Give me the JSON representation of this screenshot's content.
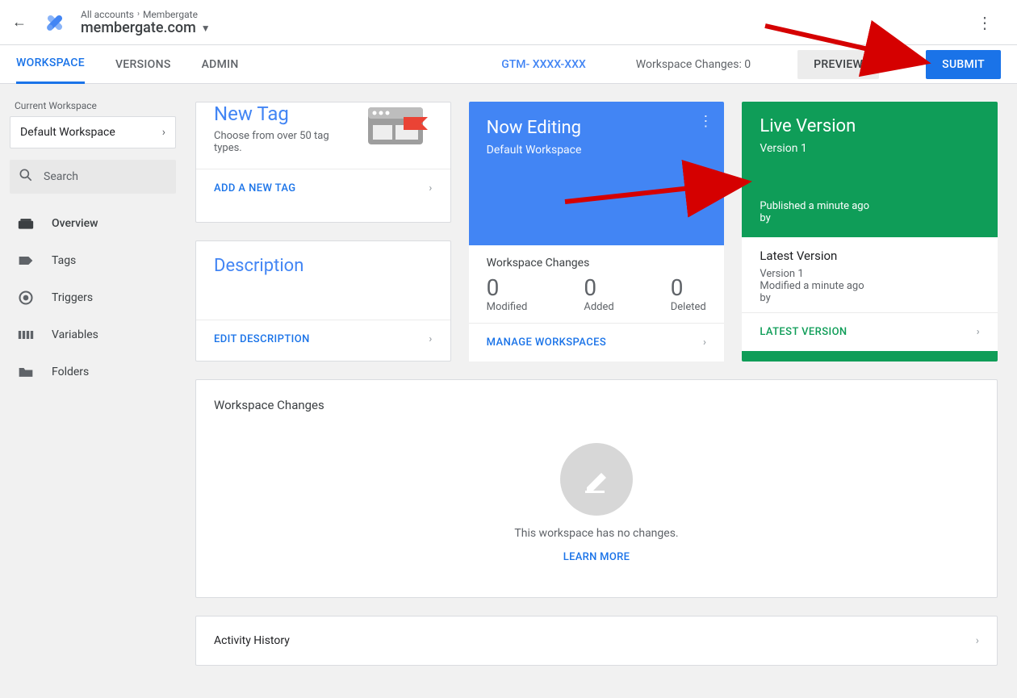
{
  "header": {
    "breadcrumb": {
      "root": "All accounts",
      "leaf": "Membergate"
    },
    "container": "membergate.com"
  },
  "subnav": {
    "tabs": {
      "workspace": "WORKSPACE",
      "versions": "VERSIONS",
      "admin": "ADMIN"
    },
    "gtm_id": "GTM- XXXX-XXX",
    "changes_label": "Workspace Changes: 0",
    "preview": "PREVIEW",
    "submit": "SUBMIT"
  },
  "sidebar": {
    "current_label": "Current Workspace",
    "workspace": "Default Workspace",
    "search_placeholder": "Search",
    "items": {
      "overview": "Overview",
      "tags": "Tags",
      "triggers": "Triggers",
      "variables": "Variables",
      "folders": "Folders"
    }
  },
  "cards": {
    "newtag": {
      "title": "New Tag",
      "sub": "Choose from over 50 tag types.",
      "action": "ADD A NEW TAG"
    },
    "description": {
      "title": "Description",
      "action": "EDIT DESCRIPTION"
    },
    "now": {
      "title": "Now Editing",
      "sub": "Default Workspace",
      "stats_title": "Workspace Changes",
      "modified": {
        "num": "0",
        "label": "Modified"
      },
      "added": {
        "num": "0",
        "label": "Added"
      },
      "deleted": {
        "num": "0",
        "label": "Deleted"
      },
      "action": "MANAGE WORKSPACES"
    },
    "live": {
      "title": "Live Version",
      "sub": "Version 1",
      "published": "Published a minute ago",
      "by": "by",
      "latest_title": "Latest Version",
      "latest_ver": "Version 1",
      "modified": "Modified a minute ago",
      "by2": "by",
      "action": "LATEST VERSION"
    }
  },
  "workspace_panel": {
    "title": "Workspace Changes",
    "empty_msg": "This workspace has no changes.",
    "learn": "LEARN MORE"
  },
  "activity": {
    "title": "Activity History"
  }
}
